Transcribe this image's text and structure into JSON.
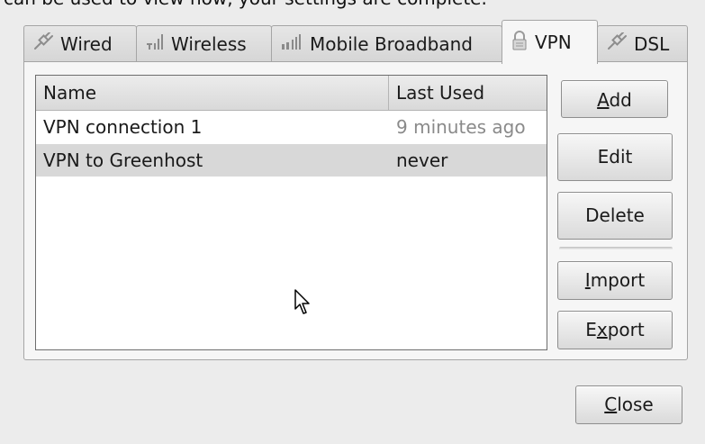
{
  "top_text": "can be used to view how, your settings are complete.",
  "tabs": [
    {
      "label": "Wired",
      "icon": "plug-icon"
    },
    {
      "label": "Wireless",
      "icon": "wireless-signal-icon"
    },
    {
      "label": "Mobile Broadband",
      "icon": "mobile-signal-icon"
    },
    {
      "label": "VPN",
      "icon": "lock-icon",
      "active": true
    },
    {
      "label": "DSL",
      "icon": "plug-icon"
    }
  ],
  "list": {
    "columns": [
      "Name",
      "Last Used"
    ],
    "rows": [
      {
        "name": "VPN connection 1",
        "last_used": "9 minutes ago"
      },
      {
        "name": "VPN to Greenhost",
        "last_used": "never",
        "selected": true
      }
    ]
  },
  "buttons": {
    "add": {
      "pre": "",
      "mnemonic": "A",
      "post": "dd"
    },
    "edit": "Edit",
    "delete": "Delete",
    "import": {
      "pre": "",
      "mnemonic": "I",
      "post": "mport"
    },
    "export": {
      "pre": "E",
      "mnemonic": "x",
      "post": "port"
    },
    "close": {
      "pre": "",
      "mnemonic": "C",
      "post": "lose"
    }
  },
  "colors": {
    "background": "#ececec",
    "panel": "#f6f6f6",
    "selected_row": "#d8d8d8",
    "dim_text": "#8a8a8a"
  }
}
